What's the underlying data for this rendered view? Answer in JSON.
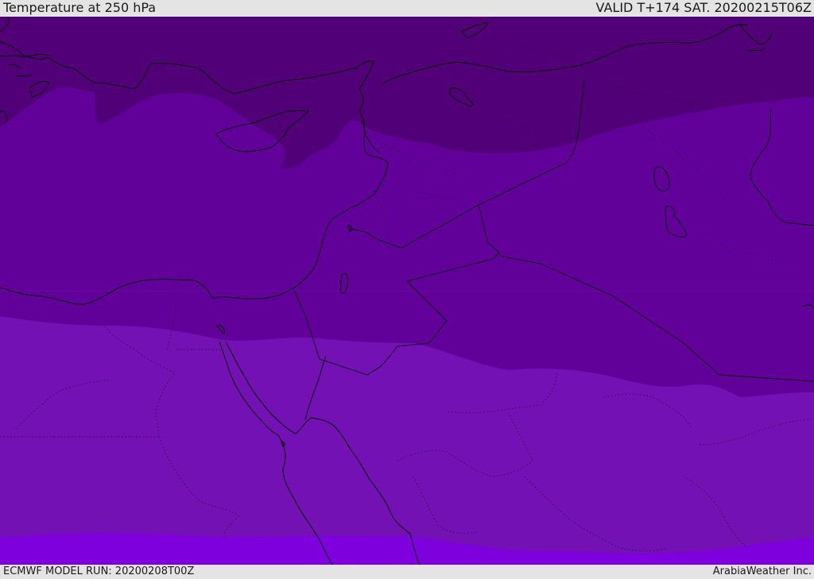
{
  "header": {
    "title": "Temperature at 250 hPa",
    "valid": "VALID T+174 SAT. 20200215T06Z"
  },
  "footer": {
    "model_run": "ECMWF MODEL RUN: 20200208T00Z",
    "credit": "ArabiaWeather Inc."
  },
  "colors": {
    "band_1": "#520078",
    "band_2": "#62009A",
    "band_3": "#7411B4",
    "band_4": "#7D00DD",
    "boundaries": "#000000"
  }
}
